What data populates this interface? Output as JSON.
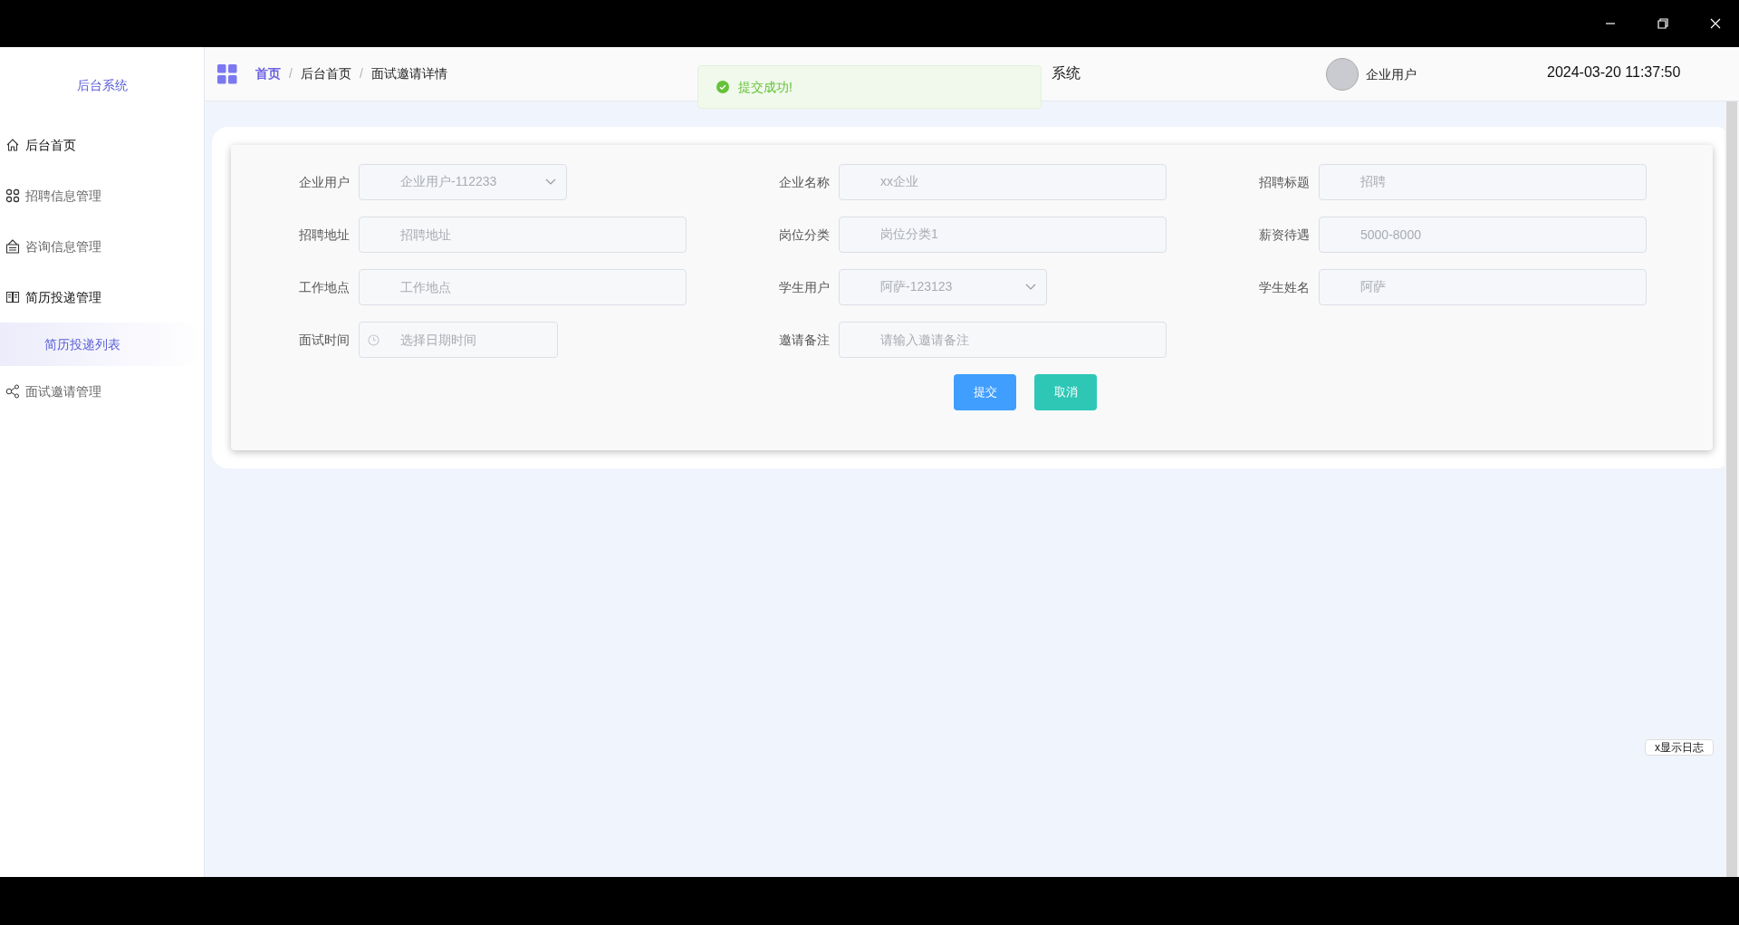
{
  "sidebar": {
    "title": "后台系统",
    "items": [
      {
        "label": "后台首页",
        "selected": false,
        "emphasized": true
      },
      {
        "label": "招聘信息管理",
        "selected": false,
        "emphasized": false
      },
      {
        "label": "咨询信息管理",
        "selected": false,
        "emphasized": false
      },
      {
        "label": "简历投递管理",
        "selected": false,
        "emphasized": true,
        "children": [
          {
            "label": "简历投递列表",
            "selected": true
          }
        ]
      },
      {
        "label": "面试邀请管理",
        "selected": false,
        "emphasized": false
      }
    ]
  },
  "header": {
    "breadcrumb": [
      {
        "label": "首页",
        "link": true
      },
      {
        "separator": "/"
      },
      {
        "label": "后台首页",
        "link": false
      },
      {
        "separator": "/"
      },
      {
        "label": "面试邀请详情",
        "link": false
      }
    ],
    "title": "系统",
    "user": "企业用户",
    "datetime": "2024-03-20 11:37:50"
  },
  "toast": {
    "message": "提交成功!",
    "kind": "success"
  },
  "form": {
    "rows": [
      [
        {
          "label": "企业用户",
          "kind": "select",
          "value": "企业用户-112233",
          "disabled": true
        },
        {
          "label": "企业名称",
          "kind": "text",
          "value": "xx企业",
          "disabled": true
        },
        {
          "label": "招聘标题",
          "kind": "text",
          "value": "招聘",
          "disabled": true
        }
      ],
      [
        {
          "label": "招聘地址",
          "kind": "text",
          "placeholder": "招聘地址"
        },
        {
          "label": "岗位分类",
          "kind": "text",
          "value": "岗位分类1",
          "disabled": true
        },
        {
          "label": "薪资待遇",
          "kind": "text",
          "value": "5000-8000",
          "disabled": true
        }
      ],
      [
        {
          "label": "工作地点",
          "kind": "text",
          "placeholder": "工作地点"
        },
        {
          "label": "学生用户",
          "kind": "select",
          "value": "阿萨-123123",
          "disabled": true
        },
        {
          "label": "学生姓名",
          "kind": "text",
          "value": "阿萨",
          "disabled": true
        }
      ],
      [
        {
          "label": "面试时间",
          "kind": "datetime",
          "placeholder": "选择日期时间"
        },
        {
          "label": "邀请备注",
          "kind": "text",
          "placeholder": "请输入邀请备注"
        }
      ]
    ],
    "buttons": [
      {
        "label": "提交",
        "kind": "primary"
      },
      {
        "label": "取消",
        "kind": "cancel"
      }
    ]
  },
  "log_button": "x显示日志"
}
